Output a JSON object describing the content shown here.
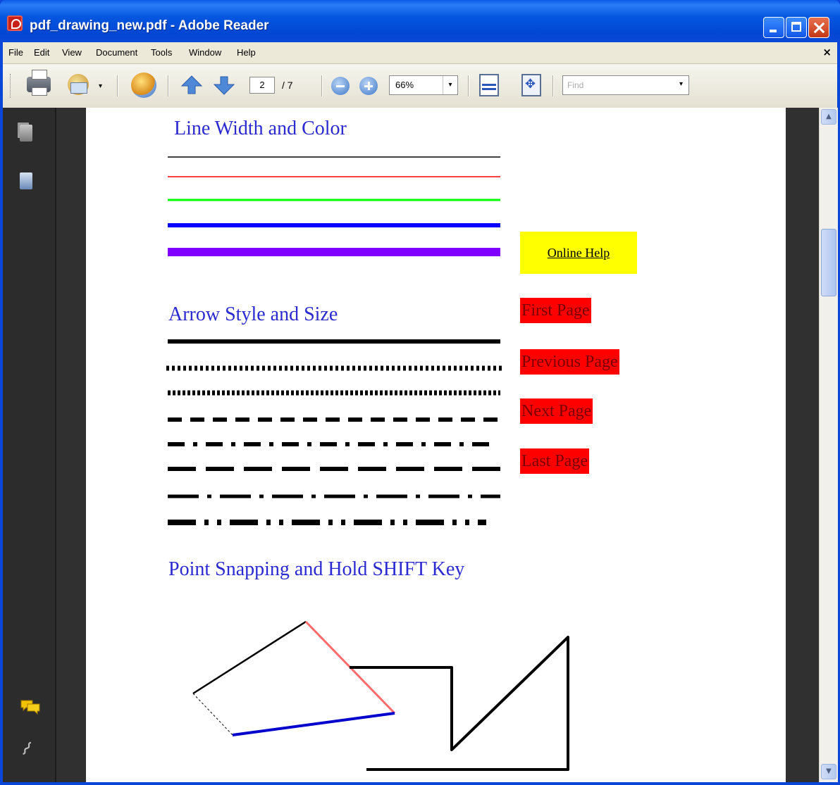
{
  "window": {
    "title": "pdf_drawing_new.pdf - Adobe Reader"
  },
  "menu": {
    "items": [
      "File",
      "Edit",
      "View",
      "Document",
      "Tools",
      "Window",
      "Help"
    ],
    "close_glyph": "×"
  },
  "toolbar": {
    "page_current": "2",
    "page_total": "/ 7",
    "zoom": "66%",
    "find_placeholder": "Find"
  },
  "document": {
    "heading_line": "Line Width and Color",
    "heading_arrow": "Arrow Style and Size",
    "heading_snap": "Point Snapping and Hold SHIFT Key",
    "online_help": "Online Help",
    "nav_buttons": [
      "First Page",
      "Previous Page",
      "Next Page",
      "Last Page"
    ],
    "line_colors": [
      "#000000",
      "#ff0000",
      "#00ff00",
      "#0000ff",
      "#8000ff"
    ],
    "button_colors": {
      "help_bg": "#ffff00",
      "nav_bg": "#ff0000"
    }
  },
  "icons": [
    "print-icon",
    "email-icon",
    "collaborate-icon",
    "previous-page-icon",
    "next-page-icon",
    "zoom-out-icon",
    "zoom-in-icon",
    "fit-width-icon",
    "fit-page-icon",
    "pages-panel-icon",
    "bookmarks-panel-icon",
    "comments-icon",
    "attachment-icon"
  ]
}
